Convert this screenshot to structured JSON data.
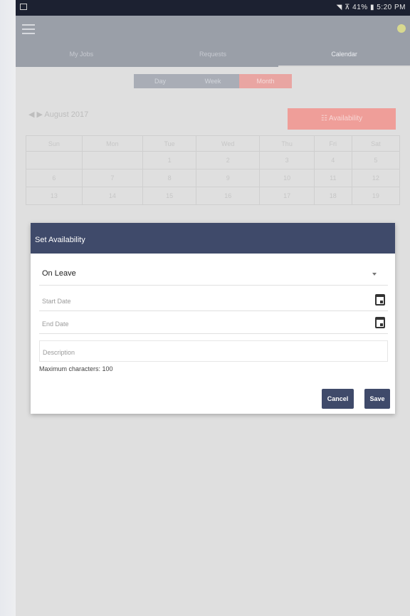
{
  "status_bar": {
    "right_text": "◥ ⊼ 41% ▮ 5:20 PM"
  },
  "app_bar": {
    "tabs": [
      {
        "label": "My Jobs"
      },
      {
        "label": "Requests"
      },
      {
        "label": "Calendar"
      }
    ]
  },
  "view_toggle": {
    "options": [
      "Day",
      "Week",
      "Month"
    ],
    "selected": "Month"
  },
  "month_nav": {
    "label": "◀ ▶  August 2017"
  },
  "availability_button": {
    "label": "☷  Availability"
  },
  "calendar": {
    "days": [
      "Sun",
      "Mon",
      "Tue",
      "Wed",
      "Thu",
      "Fri",
      "Sat"
    ],
    "rows": [
      [
        "",
        "",
        "1",
        "2",
        "3",
        "4",
        "5"
      ],
      [
        "6",
        "7",
        "8",
        "9",
        "10",
        "11",
        "12"
      ],
      [
        "13",
        "14",
        "15",
        "16",
        "17",
        "18",
        "19"
      ]
    ]
  },
  "dialog": {
    "title": "Set Availability",
    "status_value": "On Leave",
    "start_date_placeholder": "Start Date",
    "end_date_placeholder": "End Date",
    "description_placeholder": "Description",
    "max_chars": "Maximum characters: 100",
    "cancel_label": "Cancel",
    "save_label": "Save"
  }
}
